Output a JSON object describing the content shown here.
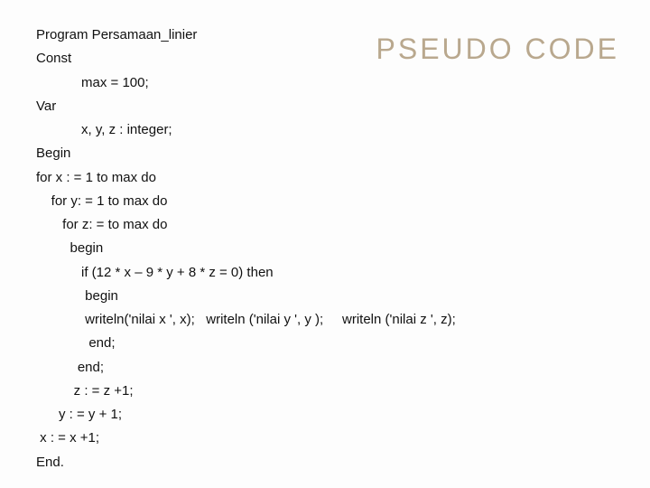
{
  "heading": "PSEUDO CODE",
  "code": {
    "l01": "Program Persamaan_linier",
    "l02": "Const",
    "l03": "            max = 100;",
    "l04": "Var",
    "l05": "            x, y, z : integer;",
    "l06": "Begin",
    "l07": "for x : = 1 to max do",
    "l08": "    for y: = 1 to max do",
    "l09": "       for z: = to max do",
    "l10": "         begin",
    "l11": "            if (12 * x – 9 * y + 8 * z = 0) then",
    "l12": "             begin",
    "l13": "             writeln('nilai x ', x);   writeln ('nilai y ', y );     writeln ('nilai z ', z);",
    "l14": "              end;",
    "l15": "           end;",
    "l16": "          z : = z +1;",
    "l17": "      y : = y + 1;",
    "l18": " x : = x +1;",
    "l19": "End."
  }
}
